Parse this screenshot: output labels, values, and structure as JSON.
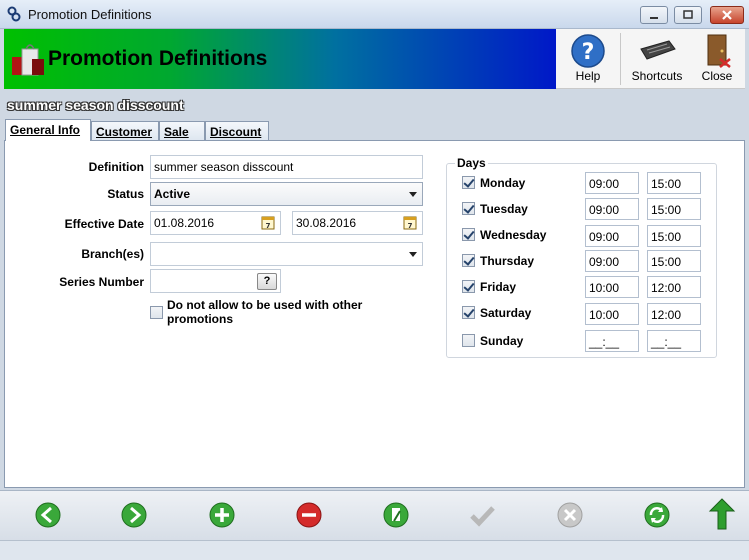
{
  "window": {
    "title": "Promotion Definitions"
  },
  "header": {
    "title": "Promotion Definitions",
    "tools": [
      {
        "label": "Help",
        "icon": "help-icon"
      },
      {
        "label": "Shortcuts",
        "icon": "keyboard-icon"
      },
      {
        "label": "Close",
        "icon": "exit-door-icon"
      }
    ]
  },
  "record": {
    "name": "summer season disscount"
  },
  "tabs": [
    "General Info",
    "Customer",
    "Sale",
    "Discount"
  ],
  "form": {
    "definition_label": "Definition",
    "definition_value": "summer season disscount",
    "status_label": "Status",
    "status_value": "Active",
    "effective_date_label": "Effective Date",
    "effective_start": "01.08.2016",
    "effective_end": "30.08.2016",
    "branches_label": "Branch(es)",
    "branches_value": "",
    "series_label": "Series Number",
    "series_value": "",
    "series_button": "?",
    "no_combine_label": "Do not allow to be used with other promotions",
    "no_combine_checked": false
  },
  "days": {
    "title": "Days",
    "items": [
      {
        "name": "Monday",
        "checked": true,
        "start": "09:00",
        "end": "15:00"
      },
      {
        "name": "Tuesday",
        "checked": true,
        "start": "09:00",
        "end": "15:00"
      },
      {
        "name": "Wednesday",
        "checked": true,
        "start": "09:00",
        "end": "15:00"
      },
      {
        "name": "Thursday",
        "checked": true,
        "start": "09:00",
        "end": "15:00"
      },
      {
        "name": "Friday",
        "checked": true,
        "start": "10:00",
        "end": "12:00"
      },
      {
        "name": "Saturday",
        "checked": true,
        "start": "10:00",
        "end": "12:00"
      },
      {
        "name": "Sunday",
        "checked": false,
        "start": "__:__",
        "end": "__:__"
      }
    ]
  },
  "bottom_actions": [
    {
      "icon": "back-arrow-icon",
      "color": "#3aa83a"
    },
    {
      "icon": "forward-arrow-icon",
      "color": "#3aa83a"
    },
    {
      "icon": "add-icon",
      "color": "#3aa83a"
    },
    {
      "icon": "delete-icon",
      "color": "#d42b2b"
    },
    {
      "icon": "edit-icon",
      "color": "#3aa83a"
    },
    {
      "icon": "save-check-icon",
      "color": "#b8b8b8"
    },
    {
      "icon": "cancel-icon",
      "color": "#b8b8b8"
    },
    {
      "icon": "refresh-icon",
      "color": "#3aa83a"
    },
    {
      "icon": "up-arrow-icon",
      "color": "#2e9e2e"
    }
  ]
}
